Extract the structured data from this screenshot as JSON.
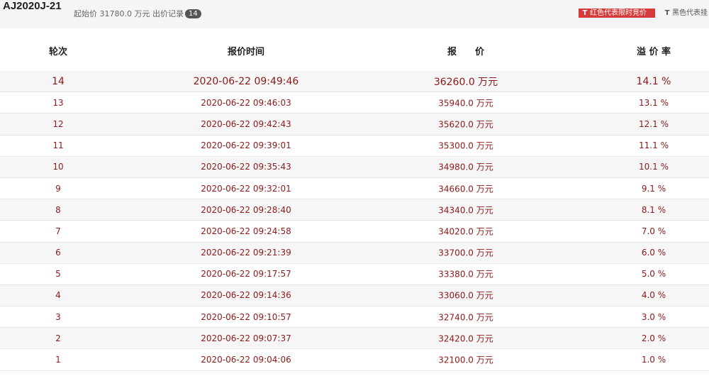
{
  "header": {
    "lot_code": "AJ2020J-21",
    "start_price_label": "起始价",
    "start_price_value": "31780.0",
    "unit": "万元",
    "bid_record_label": "出价记录",
    "bid_count": "14",
    "legend_red_text": "红色代表限时竞价",
    "legend_black_text": "黑色代表挂",
    "legend_icon": "T"
  },
  "columns": {
    "round": "轮次",
    "time": "报价时间",
    "price": "报　　价",
    "premium": "溢 价 率"
  },
  "colors": {
    "text_red": "#8b1a1a",
    "legend_red_bg": "#d63a3a"
  },
  "rows": [
    {
      "round": "14",
      "time": "2020-06-22 09:49:46",
      "price": "36260.0 万元",
      "premium": "14.1 %"
    },
    {
      "round": "13",
      "time": "2020-06-22 09:46:03",
      "price": "35940.0 万元",
      "premium": "13.1 %"
    },
    {
      "round": "12",
      "time": "2020-06-22 09:42:43",
      "price": "35620.0 万元",
      "premium": "12.1 %"
    },
    {
      "round": "11",
      "time": "2020-06-22 09:39:01",
      "price": "35300.0 万元",
      "premium": "11.1 %"
    },
    {
      "round": "10",
      "time": "2020-06-22 09:35:43",
      "price": "34980.0 万元",
      "premium": "10.1 %"
    },
    {
      "round": "9",
      "time": "2020-06-22 09:32:01",
      "price": "34660.0 万元",
      "premium": "9.1 %"
    },
    {
      "round": "8",
      "time": "2020-06-22 09:28:40",
      "price": "34340.0 万元",
      "premium": "8.1 %"
    },
    {
      "round": "7",
      "time": "2020-06-22 09:24:58",
      "price": "34020.0 万元",
      "premium": "7.0 %"
    },
    {
      "round": "6",
      "time": "2020-06-22 09:21:39",
      "price": "33700.0 万元",
      "premium": "6.0 %"
    },
    {
      "round": "5",
      "time": "2020-06-22 09:17:57",
      "price": "33380.0 万元",
      "premium": "5.0 %"
    },
    {
      "round": "4",
      "time": "2020-06-22 09:14:36",
      "price": "33060.0 万元",
      "premium": "4.0 %"
    },
    {
      "round": "3",
      "time": "2020-06-22 09:10:57",
      "price": "32740.0 万元",
      "premium": "3.0 %"
    },
    {
      "round": "2",
      "time": "2020-06-22 09:07:37",
      "price": "32420.0 万元",
      "premium": "2.0 %"
    },
    {
      "round": "1",
      "time": "2020-06-22 09:04:06",
      "price": "32100.0 万元",
      "premium": "1.0 %"
    }
  ]
}
